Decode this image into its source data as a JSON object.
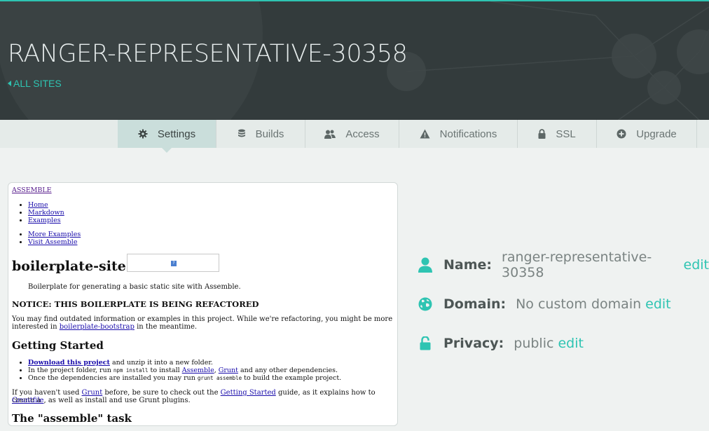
{
  "header": {
    "title": "RANGER-REPRESENTATIVE-30358",
    "back_link": "ALL SITES",
    "accent": "#2ec4b2",
    "background": "#333b3c"
  },
  "tabs": [
    {
      "label": "Settings",
      "icon": "gear-icon",
      "active": true
    },
    {
      "label": "Builds",
      "icon": "database-icon",
      "active": false
    },
    {
      "label": "Access",
      "icon": "users-icon",
      "active": false
    },
    {
      "label": "Notifications",
      "icon": "warning-icon",
      "active": false
    },
    {
      "label": "SSL",
      "icon": "lock-icon",
      "active": false
    },
    {
      "label": "Upgrade",
      "icon": "plus-circle-icon",
      "active": false
    }
  ],
  "preview": {
    "brand": "ASSEMBLE",
    "nav1": [
      "Home",
      "Markdown",
      "Examples"
    ],
    "nav2": [
      "More Examples",
      "Visit Assemble"
    ],
    "heading": "boilerplate-site",
    "tagline": "Boilerplate for generating a basic static site with Assemble.",
    "notice": "NOTICE: THIS BOILERPLATE IS BEING REFACTORED",
    "notice_text_1": "You may find outdated information or examples in this project. While we're refactoring, you might be more",
    "notice_text_2_pre": "interested in ",
    "notice_link": "boilerplate-bootstrap",
    "notice_text_2_post": " in the meantime.",
    "getting_started": "Getting Started",
    "steps": {
      "download_link": "Download this project",
      "download_rest": " and unzip it into a new folder.",
      "run_pre": "In the project folder, run ",
      "run_code": "npm install",
      "run_mid": " to install ",
      "assemble_link": "Assemble",
      "comma": ", ",
      "grunt_link": "Grunt",
      "run_post": " and any other dependencies.",
      "deps_pre": "Once the dependencies are installed you may run ",
      "deps_code": "grunt assemble",
      "deps_post": " to build the example project."
    },
    "grunt_text": {
      "pre": "If you haven't used ",
      "grunt": "Grunt",
      "mid": " before, be sure to check out the ",
      "guide": "Getting Started",
      "post": " guide, as it explains how to create a",
      "gruntfile": "Gruntfile",
      "end": ", as well as install and use Grunt plugins."
    },
    "task_heading": "The \"assemble\" task"
  },
  "info": {
    "name_label": "Name:",
    "name_value": "ranger-representative-30358",
    "domain_label": "Domain:",
    "domain_value": "No custom domain",
    "privacy_label": "Privacy:",
    "privacy_value": "public",
    "edit": "edit"
  }
}
